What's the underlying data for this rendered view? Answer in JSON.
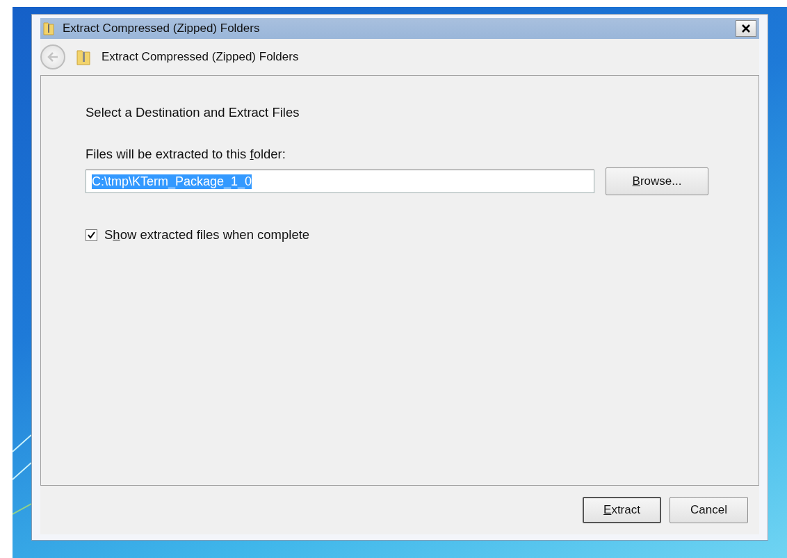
{
  "window": {
    "title": "Extract Compressed (Zipped) Folders"
  },
  "navigation": {
    "title": "Extract Compressed (Zipped) Folders",
    "back_disabled": true
  },
  "heading": "Select a Destination and Extract Files",
  "destination": {
    "label": {
      "before": "Files will be extracted to this ",
      "access_key": "f",
      "after": "older:"
    },
    "value": "C:\\tmp\\KTerm_Package_1_0",
    "value_selected": true,
    "browse_button": {
      "access_key": "B",
      "after": "rowse..."
    }
  },
  "show_files": {
    "label": {
      "before": "S",
      "access_key": "h",
      "after": "ow extracted files when complete"
    },
    "checked": true
  },
  "buttons": [
    {
      "label": {
        "access_key": "E",
        "after": "xtract"
      },
      "default": true
    },
    {
      "label": {
        "before": "Cancel"
      },
      "default": false
    }
  ]
}
